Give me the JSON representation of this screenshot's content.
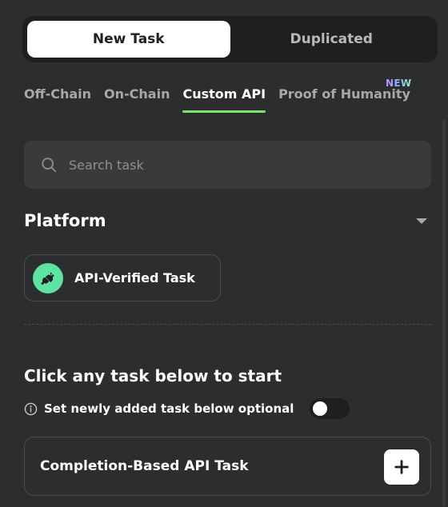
{
  "segmented": {
    "new_task": "New Task",
    "duplicated": "Duplicated"
  },
  "tabs": [
    {
      "label": "Off-Chain"
    },
    {
      "label": "On-Chain"
    },
    {
      "label": "Custom API"
    },
    {
      "label": "Proof of Humanity"
    }
  ],
  "tab_badge": "NEW",
  "search": {
    "placeholder": "Search task"
  },
  "platform": {
    "title": "Platform",
    "items": [
      {
        "label": "API-Verified Task"
      }
    ]
  },
  "tasks": {
    "title": "Click any task below to start",
    "optional_label": "Set newly added task below optional",
    "optional_enabled": false,
    "items": [
      {
        "label": "Completion-Based API Task"
      }
    ]
  },
  "colors": {
    "background": "#2c2d2e",
    "active_tab_underline": "#7ee36a",
    "chip_icon": "#5ee4a2"
  },
  "icons": {
    "search": "search-icon",
    "platform_toggle": "chevron-down-icon",
    "api": "plug-icon",
    "info": "info-icon",
    "add": "plus-icon"
  }
}
